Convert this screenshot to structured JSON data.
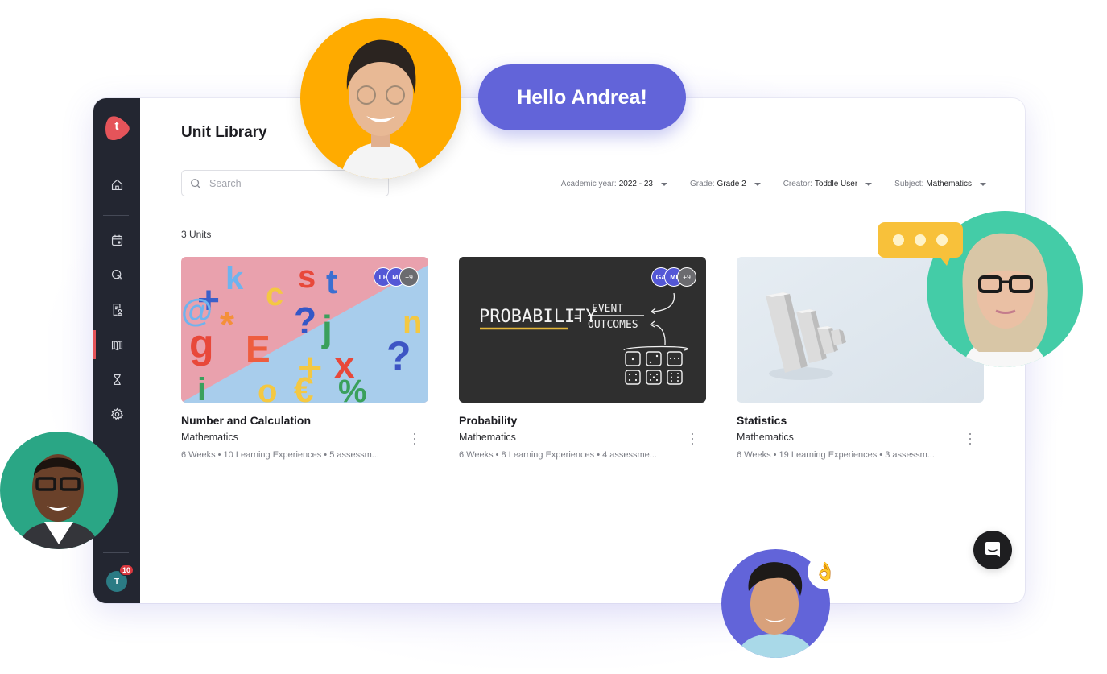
{
  "app": {
    "logo_letter": "t",
    "brand_color": "#e5545a",
    "sidebar": {
      "items": [
        {
          "name": "home",
          "icon": "home-icon"
        },
        {
          "name": "calendar",
          "icon": "calendar-icon"
        },
        {
          "name": "messages",
          "icon": "chat-bubbles-icon"
        },
        {
          "name": "reports",
          "icon": "student-report-icon"
        },
        {
          "name": "unit-library",
          "icon": "book-library-icon",
          "active": true
        },
        {
          "name": "profile",
          "icon": "hourglass-user-icon"
        },
        {
          "name": "settings",
          "icon": "gear-icon"
        }
      ],
      "user_initial": "T",
      "notification_count": "10"
    }
  },
  "header": {
    "title": "Unit Library"
  },
  "search": {
    "placeholder": "Search",
    "value": ""
  },
  "filters": [
    {
      "label": "Academic year:",
      "value": "2022 - 23"
    },
    {
      "label": "Grade:",
      "value": "Grade 2"
    },
    {
      "label": "Creator:",
      "value": "Toddle User"
    },
    {
      "label": "Subject:",
      "value": "Mathematics"
    }
  ],
  "units_count": "3 Units",
  "units": [
    {
      "title": "Number and Calculation",
      "subject": "Mathematics",
      "meta": "6 Weeks • 10 Learning Experiences • 5 assessm...",
      "collaborators": [
        "LE",
        "MI"
      ],
      "more_collaborators": "+9",
      "image": "colorful-letters-and-math-symbols"
    },
    {
      "title": "Probability",
      "subject": "Mathematics",
      "meta": "6 Weeks • 8 Learning Experiences • 4 assessme...",
      "collaborators": [
        "GA",
        "MI"
      ],
      "more_collaborators": "+9",
      "image": "probability-chalkboard",
      "chalk": {
        "left": "PROBABILITY",
        "eq": "=",
        "numerator": "EVENT",
        "denominator": "OUTCOMES"
      }
    },
    {
      "title": "Statistics",
      "subject": "Mathematics",
      "meta": "6 Weeks • 19 Learning Experiences • 3 assessm...",
      "collaborators": [],
      "more_collaborators": "",
      "image": "3d-bar-graph"
    }
  ],
  "overlay": {
    "greeting": "Hello Andrea!",
    "ok_emoji": "👌",
    "accent_purple": "#6264d9",
    "persona_colors": {
      "orange": "#ffab00",
      "teal": "#44cca7",
      "green": "#2aa685",
      "purple": "#6264d9"
    }
  }
}
